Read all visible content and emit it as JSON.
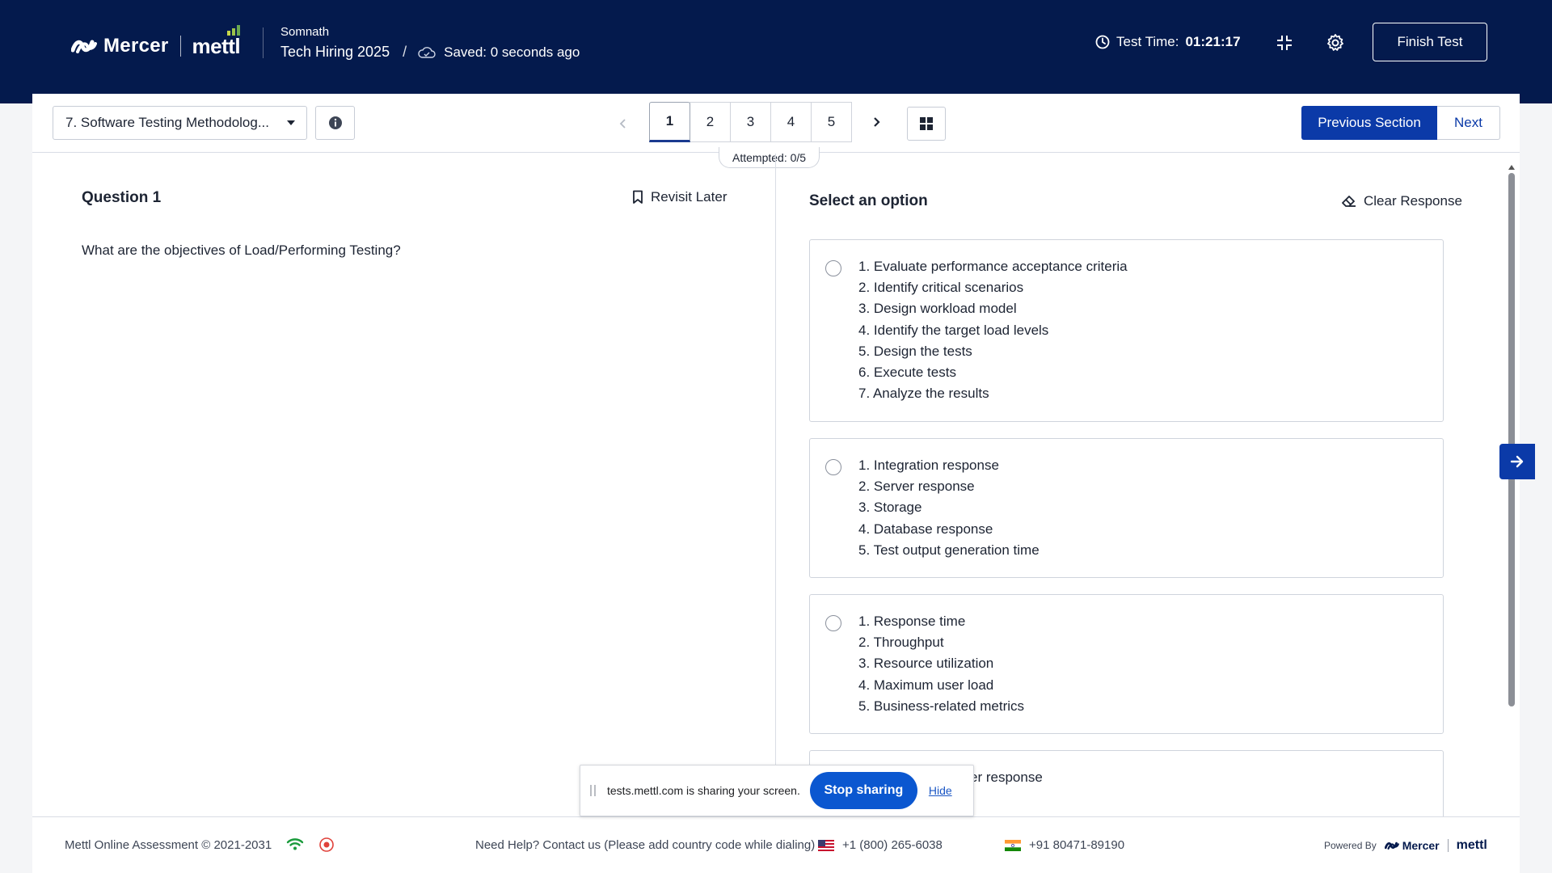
{
  "header": {
    "brand_mercer": "Mercer",
    "brand_mettl": "mettl",
    "candidate_name": "Somnath",
    "test_name": "Tech Hiring 2025",
    "separator": "/",
    "saved_status": "Saved: 0 seconds ago",
    "timer_label": "Test Time:",
    "timer_value": "01:21:17",
    "finish_label": "Finish Test",
    "icons": [
      "clock-icon",
      "minimize-icon",
      "gear-icon"
    ]
  },
  "toolbar": {
    "section": "7. Software Testing Methodolog...",
    "question_numbers": [
      "1",
      "2",
      "3",
      "4",
      "5"
    ],
    "active_question": "1",
    "attempted": "Attempted: 0/5",
    "previous_section": "Previous Section",
    "next": "Next"
  },
  "question": {
    "title": "Question 1",
    "revisit_label": "Revisit Later",
    "text": "What are the objectives of Load/Performing Testing?"
  },
  "options_panel": {
    "title": "Select an option",
    "clear_label": "Clear Response",
    "options": [
      {
        "lines": [
          "1. Evaluate performance acceptance criteria",
          "2. Identify critical scenarios",
          "3. Design workload model",
          "4. Identify the target load levels",
          "5. Design the tests",
          "6. Execute tests",
          "7. Analyze the results"
        ]
      },
      {
        "lines": [
          "1. Integration response",
          "2. Server response",
          "3. Storage",
          "4. Database response",
          "5. Test output generation time"
        ]
      },
      {
        "lines": [
          "1. Response time",
          "2. Throughput",
          "3. Resource utilization",
          "4. Maximum user load",
          "5. Business-related metrics"
        ]
      },
      {
        "lines": [
          "er response"
        ]
      }
    ]
  },
  "footer": {
    "copyright": "Mettl Online Assessment © 2021-2031",
    "help": "Need Help? Contact us (Please add country code while dialing)",
    "us_phone": "+1 (800) 265-6038",
    "in_phone": "+91 80471-89190",
    "powered_by": "Powered By",
    "powered_mercer": "Mercer",
    "powered_mettl": "mettl"
  },
  "share_bar": {
    "message": "tests.mettl.com is sharing your screen.",
    "stop_label": "Stop sharing",
    "hide_label": "Hide"
  },
  "colors": {
    "header_bg": "#041a4d",
    "primary": "#0b3aa8",
    "stop_sharing": "#0b57d0",
    "wifi": "#1a9b3c",
    "record": "#e0413a"
  }
}
